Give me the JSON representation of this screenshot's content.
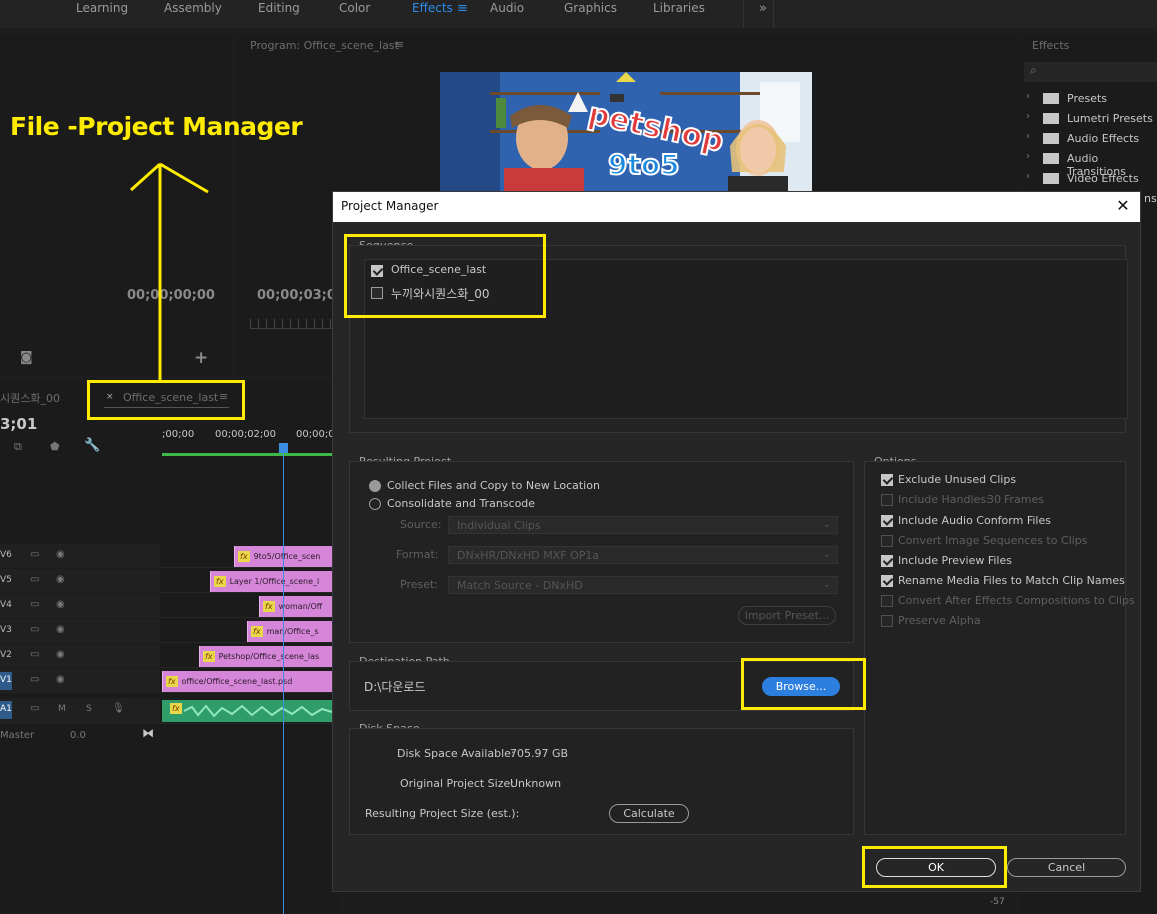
{
  "workspaces": [
    "Learning",
    "Assembly",
    "Editing",
    "Color",
    "Effects",
    "Audio",
    "Graphics",
    "Libraries"
  ],
  "workspace_active": "Effects",
  "workspace_more": "»",
  "program": {
    "title": "Program: Office_scene_last",
    "timecode_left": "00;00;00;00",
    "timecode_right": "00;00;03;01"
  },
  "preview": {
    "brand_line1": "petshop",
    "brand_line2": "9to5"
  },
  "effects_panel": {
    "title": "Effects",
    "items": [
      "Presets",
      "Lumetri Presets",
      "Audio Effects",
      "Audio Transitions",
      "Video Effects"
    ],
    "partial_item": "ns"
  },
  "annotation": {
    "label": "File -Project Manager"
  },
  "timeline": {
    "tab_inactive": "시퀀스화_00",
    "tab_active": "Office_scene_last",
    "tab_close": "×",
    "timecode": "3;01",
    "ruler": [
      ";00;00",
      "00;00;02;00",
      "00;00;0"
    ],
    "tracks": [
      {
        "label": "V6",
        "clip": "9to5/Office_scen"
      },
      {
        "label": "V5",
        "clip": "Layer 1/Office_scene_l"
      },
      {
        "label": "V4",
        "clip": "woman/Off"
      },
      {
        "label": "V3",
        "clip": "man/Office_s"
      },
      {
        "label": "V2",
        "clip": "Petshop/Office_scene_las"
      },
      {
        "label": "V1",
        "clip": "office/Office_scene_last.psd"
      },
      {
        "label": "A1",
        "clip": "fx"
      }
    ],
    "master_label": "Master",
    "master_value": "0.0",
    "audio_m": "M",
    "audio_s": "S"
  },
  "dialog": {
    "title": "Project Manager",
    "close": "✕",
    "sequence": {
      "label": "Sequence",
      "items": [
        {
          "name": "Office_scene_last",
          "checked": true
        },
        {
          "name": "누끼와시퀀스화_00",
          "checked": false
        }
      ]
    },
    "resulting_project": {
      "label": "Resulting Project",
      "option_collect": "Collect Files and Copy to New Location",
      "option_consolidate": "Consolidate and Transcode",
      "source_label": "Source:",
      "source_value": "Individual Clips",
      "format_label": "Format:",
      "format_value": "DNxHR/DNxHD MXF OP1a",
      "preset_label": "Preset:",
      "preset_value": "Match Source - DNxHD",
      "import_preset": "Import Preset..."
    },
    "options": {
      "label": "Options",
      "items": [
        {
          "text": "Exclude Unused Clips",
          "checked": true,
          "enabled": true
        },
        {
          "text": "Include Handles:",
          "checked": false,
          "enabled": false
        },
        {
          "text": "Include Audio Conform Files",
          "checked": true,
          "enabled": true
        },
        {
          "text": "Convert Image Sequences to Clips",
          "checked": false,
          "enabled": false
        },
        {
          "text": "Include Preview Files",
          "checked": true,
          "enabled": true
        },
        {
          "text": "Rename Media Files to Match Clip Names",
          "checked": true,
          "enabled": true
        },
        {
          "text": "Convert After Effects Compositions to Clips",
          "checked": false,
          "enabled": false
        },
        {
          "text": "Preserve Alpha",
          "checked": false,
          "enabled": false
        }
      ],
      "handles_value": "30",
      "handles_unit": "Frames"
    },
    "destination": {
      "label": "Destination Path",
      "path": "D:\\다운로드",
      "browse": "Browse..."
    },
    "disk_space": {
      "label": "Disk Space",
      "available_label": "Disk Space Available:",
      "available_value": "705.97 GB",
      "original_label": "Original Project Size:",
      "original_value": "Unknown",
      "resulting_label": "Resulting Project Size (est.):",
      "calculate": "Calculate"
    },
    "ok": "OK",
    "cancel": "Cancel"
  },
  "meter_value": "-57"
}
